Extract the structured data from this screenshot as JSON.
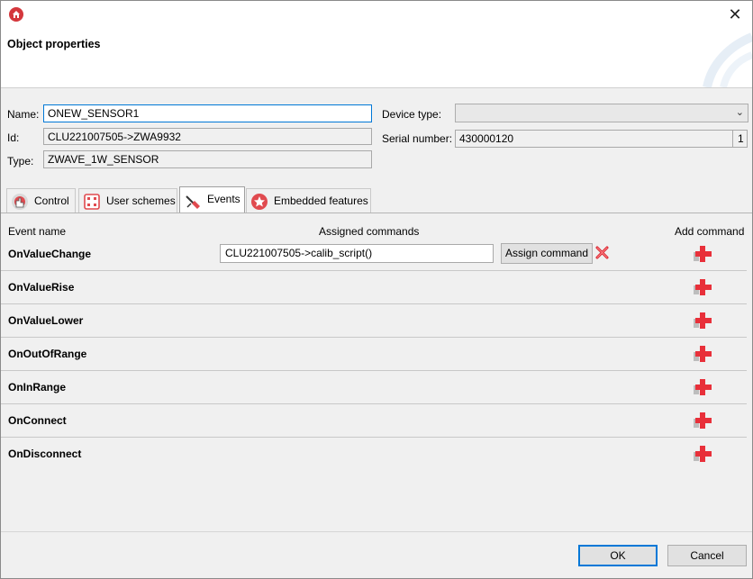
{
  "window": {
    "header_title": "Object properties",
    "close_symbol": "✕",
    "app_icon": "home-icon"
  },
  "form": {
    "name_label": "Name:",
    "name_value": "ONEW_SENSOR1",
    "id_label": "Id:",
    "id_value": "CLU221007505->ZWA9932",
    "type_label": "Type:",
    "type_value": "ZWAVE_1W_SENSOR",
    "device_type_label": "Device type:",
    "device_type_value": "",
    "serial_label": "Serial number:",
    "serial_value": "430000120",
    "serial_suffix": "1"
  },
  "tabs": [
    {
      "label": "Control",
      "icon": "hand-pointer-icon",
      "selected": false
    },
    {
      "label": "User schemes",
      "icon": "schemes-icon",
      "selected": false
    },
    {
      "label": "Events",
      "icon": "events-icon",
      "selected": true
    },
    {
      "label": "Embedded features",
      "icon": "star-icon",
      "selected": false
    }
  ],
  "events": {
    "col_event_name": "Event name",
    "col_assigned": "Assigned commands",
    "col_add": "Add command",
    "assign_button_label": "Assign command",
    "rows": [
      {
        "name": "OnValueChange",
        "command": "CLU221007505->calib_script()"
      },
      {
        "name": "OnValueRise"
      },
      {
        "name": "OnValueLower"
      },
      {
        "name": "OnOutOfRange"
      },
      {
        "name": "OnInRange"
      },
      {
        "name": "OnConnect"
      },
      {
        "name": "OnDisconnect"
      }
    ]
  },
  "footer": {
    "ok_label": "OK",
    "cancel_label": "Cancel"
  },
  "colors": {
    "accent": "#0078d7",
    "brand_red": "#d4373c",
    "add_icon_red": "#e8303a"
  }
}
